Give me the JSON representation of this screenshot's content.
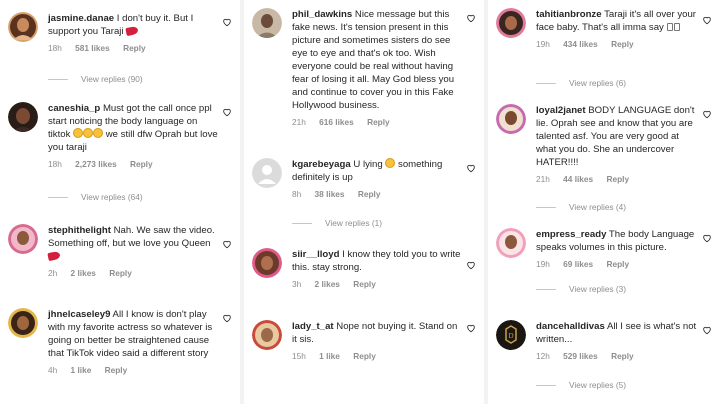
{
  "columns": [
    [
      {
        "user": "jasmine.danae",
        "text": "I don't buy it. But I support you Taraji",
        "emoji": "red",
        "time": "18h",
        "likes": "581 likes",
        "reply": "Reply",
        "view_replies": "View replies (90)"
      },
      {
        "user": "caneshia_p",
        "text": "Must got the call once ppl start noticing the body language on tiktok",
        "emoji_mid": "sad3",
        "text2": "we still dfw Oprah but love you taraji",
        "time": "18h",
        "likes": "2,273 likes",
        "reply": "Reply",
        "view_replies": "View replies (64)"
      },
      {
        "user": "stephithelight",
        "text": "Nah. We saw the video. Something off, but we love you Queen",
        "emoji": "red",
        "time": "2h",
        "likes": "2 likes",
        "reply": "Reply",
        "view_replies": ""
      },
      {
        "user": "jhnelcaseley9",
        "text": "All I know is don't play with my favorite actress so whatever is going on better be straightened cause that TikTok video said a different story",
        "time": "4h",
        "likes": "1 like",
        "reply": "Reply",
        "view_replies": ""
      }
    ],
    [
      {
        "user": "phil_dawkins",
        "text": "Nice message but this fake news. It's tension present in this picture and sometimes sisters do see eye to eye and that's ok too. Wish everyone could be real without having fear of losing it all. May God bless you and continue to cover you in this Fake Hollywood business.",
        "time": "21h",
        "likes": "616 likes",
        "reply": "Reply",
        "view_replies": ""
      },
      {
        "user": "kgarebeyaga",
        "text": "U lying",
        "emoji_mid": "sad1",
        "text2": "something definitely is up",
        "time": "8h",
        "likes": "38 likes",
        "reply": "Reply",
        "view_replies": "View replies (1)"
      },
      {
        "user": "siir__lloyd",
        "text": "I know they told you to write this. stay strong.",
        "time": "3h",
        "likes": "2 likes",
        "reply": "Reply",
        "view_replies": ""
      },
      {
        "user": "lady_t_at",
        "text": "Nope not buying it. Stand on it sis.",
        "time": "15h",
        "likes": "1 like",
        "reply": "Reply",
        "view_replies": ""
      }
    ],
    [
      {
        "user": "tahitianbronze",
        "text": "Taraji it's all over your face baby. That's all imma say",
        "emoji": "box2",
        "time": "19h",
        "likes": "434 likes",
        "reply": "Reply",
        "view_replies": "View replies (6)"
      },
      {
        "user": "loyal2janet",
        "text": "BODY LANGUAGE don't lie. Oprah see and know that you are talented asf. You are very good at what you do. She an undercover HATER!!!!",
        "time": "21h",
        "likes": "44 likes",
        "reply": "Reply",
        "view_replies": "View replies (4)"
      },
      {
        "user": "empress_ready",
        "text": "The body Language speaks volumes in this picture.",
        "time": "19h",
        "likes": "69 likes",
        "reply": "Reply",
        "view_replies": "View replies (3)"
      },
      {
        "user": "dancehalldivas",
        "text": "All I see is what's not written...",
        "time": "12h",
        "likes": "529 likes",
        "reply": "Reply",
        "view_replies": "View replies (5)"
      }
    ]
  ],
  "colors": {
    "avatar_ring": "#d9d9d9",
    "text": "#262626",
    "muted": "#8e8e8e"
  },
  "icons": {
    "heart": "heart-outline-icon"
  }
}
